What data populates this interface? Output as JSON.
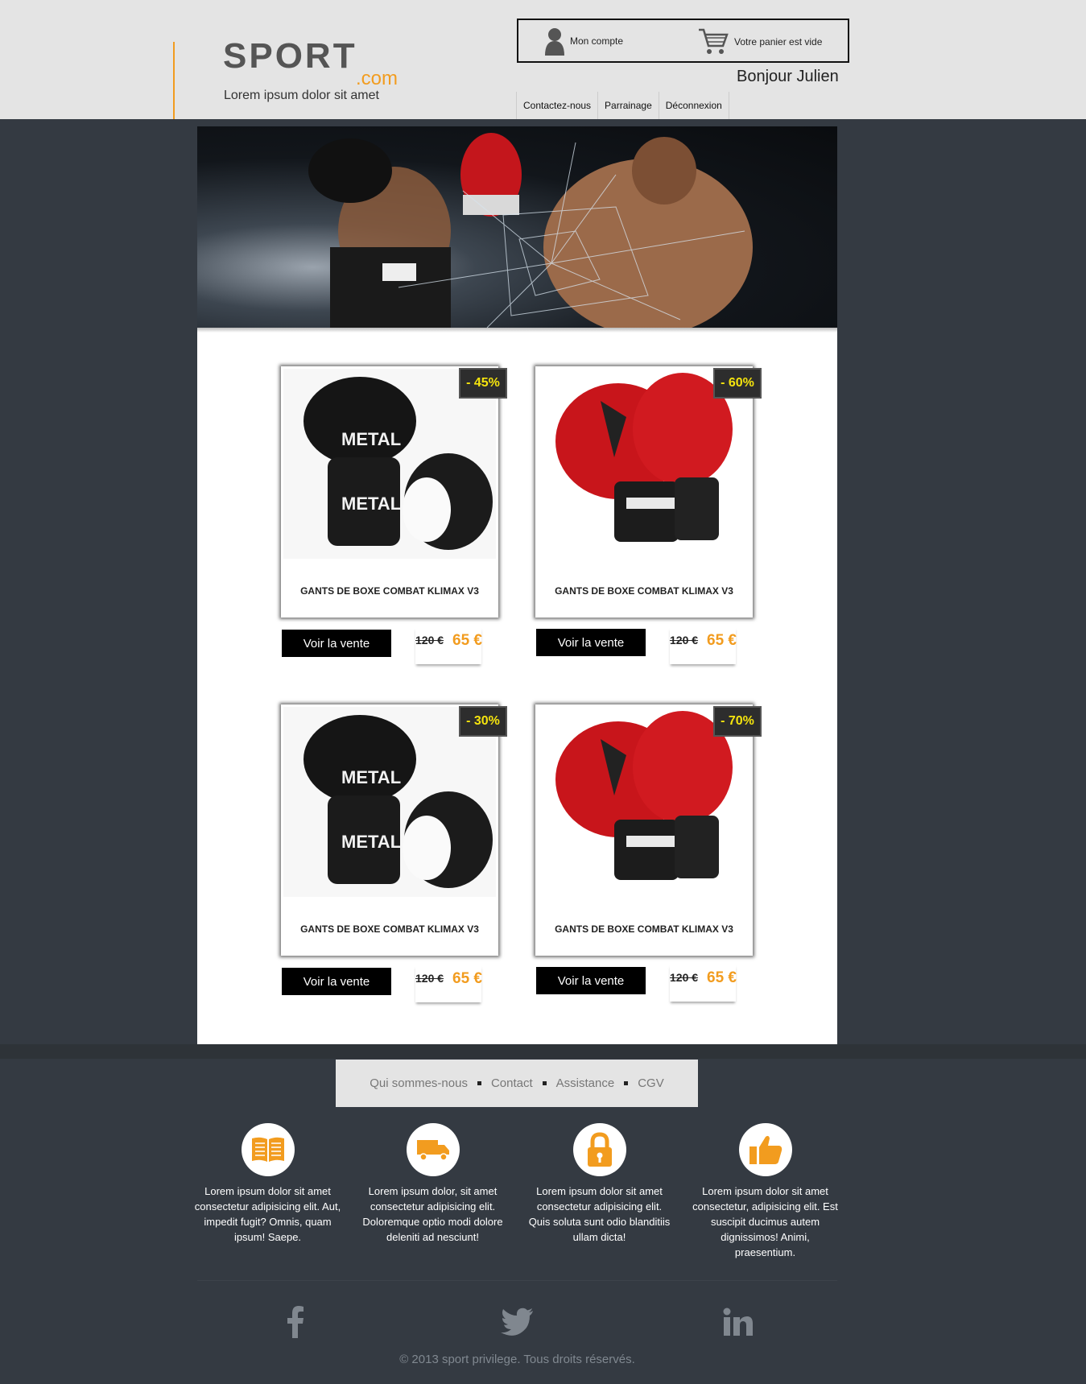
{
  "header": {
    "logo_main": "SPORT",
    "logo_sub": ".com",
    "tagline": "Lorem ipsum dolor sit amet",
    "account_label": "Mon compte",
    "cart_label": "Votre panier est vide",
    "greeting": "Bonjour Julien",
    "nav": [
      "Contactez-nous",
      "Parrainage",
      "Déconnexion"
    ]
  },
  "products": [
    {
      "title": "GANTS DE BOXE COMBAT KLIMAX V3",
      "discount": "- 45%",
      "button": "Voir la vente",
      "old_price": "120 €",
      "new_price": "65 €",
      "color": "black"
    },
    {
      "title": "GANTS DE BOXE COMBAT KLIMAX V3",
      "discount": "- 60%",
      "button": "Voir la vente",
      "old_price": "120 €",
      "new_price": "65 €",
      "color": "red"
    },
    {
      "title": "GANTS DE BOXE COMBAT KLIMAX V3",
      "discount": "- 30%",
      "button": "Voir la vente",
      "old_price": "120 €",
      "new_price": "65 €",
      "color": "black"
    },
    {
      "title": "GANTS DE BOXE COMBAT KLIMAX V3",
      "discount": "- 70%",
      "button": "Voir la vente",
      "old_price": "120 €",
      "new_price": "65 €",
      "color": "red"
    }
  ],
  "footer": {
    "nav": [
      "Qui sommes-nous",
      "Contact",
      "Assistance",
      "CGV"
    ],
    "features": [
      {
        "icon": "book-icon",
        "text": "Lorem ipsum dolor sit amet consectetur adipisicing elit. Aut, impedit fugit? Omnis, quam ipsum! Saepe."
      },
      {
        "icon": "truck-icon",
        "text": "Lorem ipsum dolor, sit amet consectetur adipisicing elit. Doloremque optio modi dolore deleniti ad nesciunt!"
      },
      {
        "icon": "lock-icon",
        "text": "Lorem ipsum dolor sit amet consectetur adipisicing elit. Quis soluta sunt odio blanditiis ullam dicta!"
      },
      {
        "icon": "thumbs-up-icon",
        "text": "Lorem ipsum dolor sit amet consectetur, adipisicing elit. Est suscipit ducimus autem dignissimos! Animi, praesentium."
      }
    ],
    "social": [
      "facebook-icon",
      "twitter-icon",
      "linkedin-icon"
    ],
    "copyright": "© 2013 sport privilege. Tous droits réservés."
  },
  "colors": {
    "accent": "#f29c1f",
    "badge_text": "#f5e40e",
    "background": "#343a42",
    "header_bg": "#e4e4e4"
  }
}
